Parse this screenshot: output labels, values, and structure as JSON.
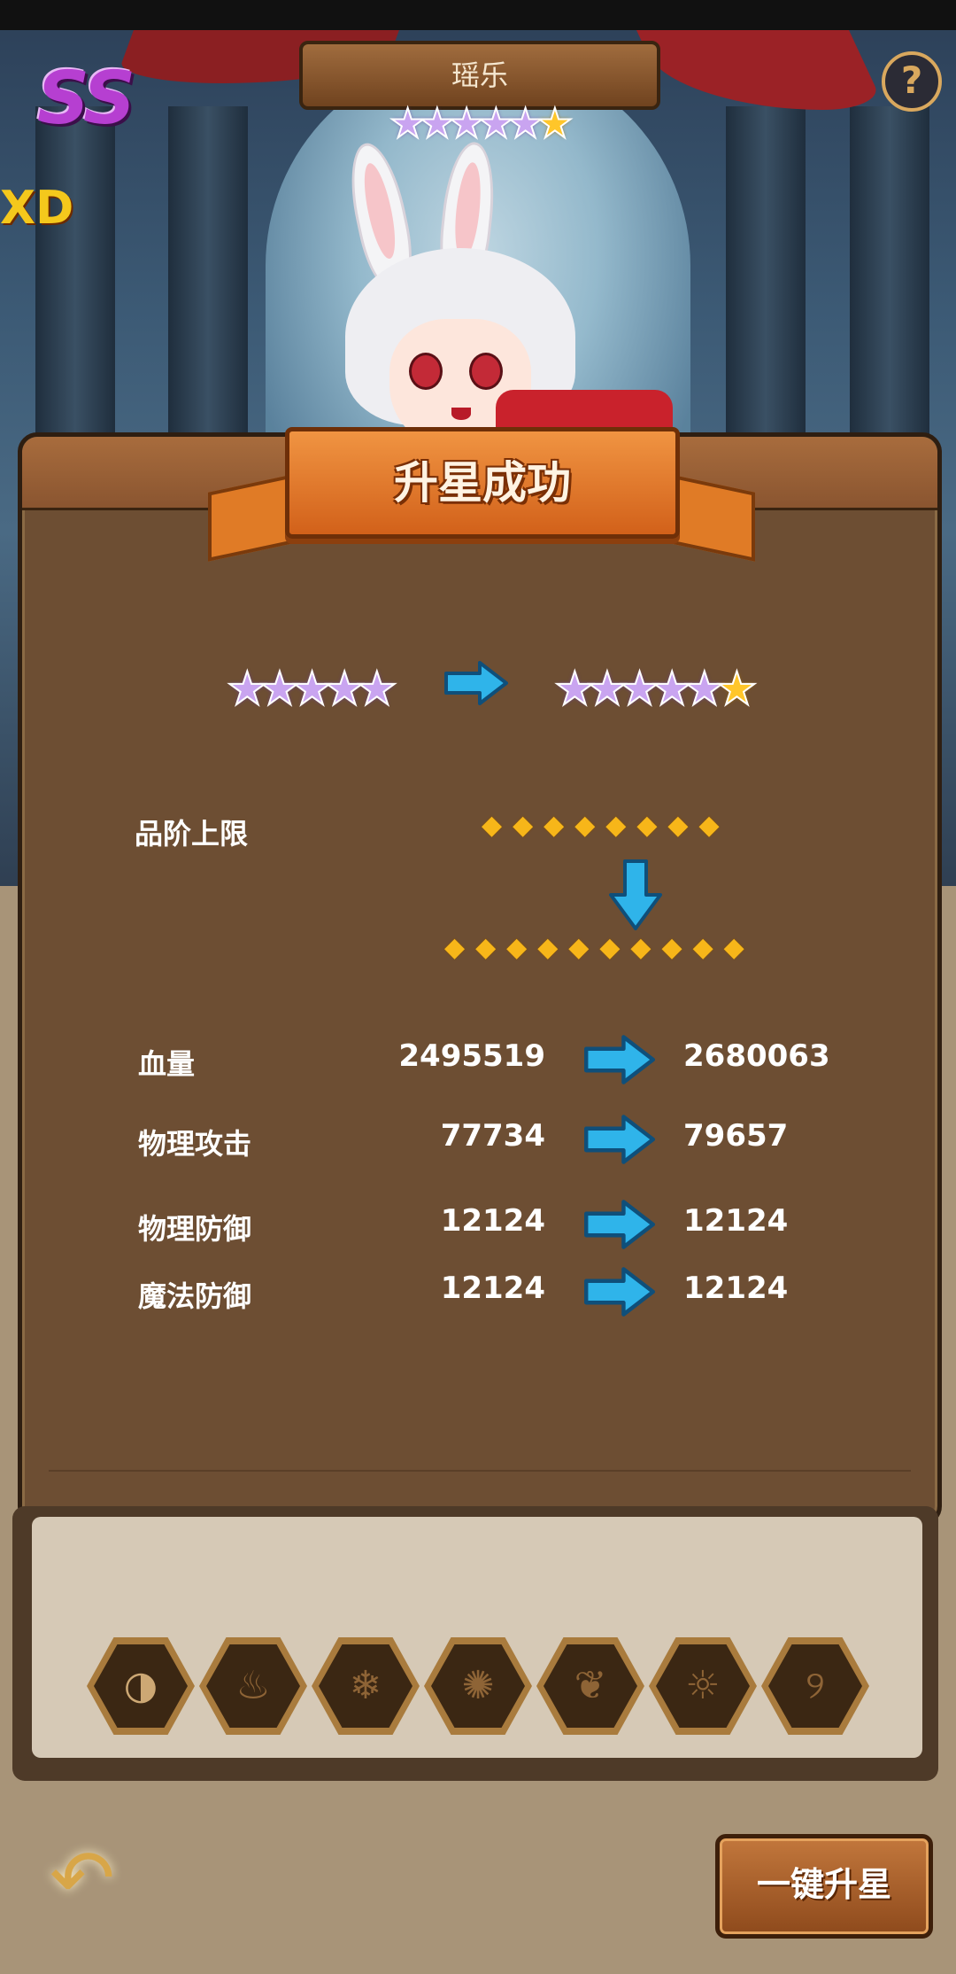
{
  "hero": {
    "name": "瑶乐",
    "rank": "SS",
    "side_text": "XD"
  },
  "help_label": "?",
  "banner_title": "升星成功",
  "star_upgrade": {
    "before": {
      "purple": 5,
      "gold": 0
    },
    "after": {
      "purple": 5,
      "gold": 1
    }
  },
  "grade_cap": {
    "label": "品阶上限",
    "before_count": 8,
    "after_count": 10
  },
  "stats": [
    {
      "label": "血量",
      "before": "2495519",
      "after": "2680063"
    },
    {
      "label": "物理攻击",
      "before": "77734",
      "after": "79657"
    },
    {
      "label": "物理防御",
      "before": "12124",
      "after": "12124"
    },
    {
      "label": "魔法防御",
      "before": "12124",
      "after": "12124"
    }
  ],
  "element_tabs": [
    {
      "name": "all-element-icon",
      "glyph": "◑",
      "active": true
    },
    {
      "name": "fire-element-icon",
      "glyph": "♨",
      "active": false
    },
    {
      "name": "ice-element-icon",
      "glyph": "❄",
      "active": false
    },
    {
      "name": "wind-element-icon",
      "glyph": "✺",
      "active": false
    },
    {
      "name": "nature-element-icon",
      "glyph": "❦",
      "active": false
    },
    {
      "name": "light-element-icon",
      "glyph": "☼",
      "active": false
    },
    {
      "name": "dark-element-icon",
      "glyph": "୨",
      "active": false
    }
  ],
  "buttons": {
    "back_glyph": "↶",
    "one_key_star": "一键升星"
  },
  "colors": {
    "panel": "#6d4e33",
    "banner": "#e07b26",
    "arrow": "#2fb4ea",
    "diamond": "#f7b619",
    "rank": "#b63fd1"
  }
}
